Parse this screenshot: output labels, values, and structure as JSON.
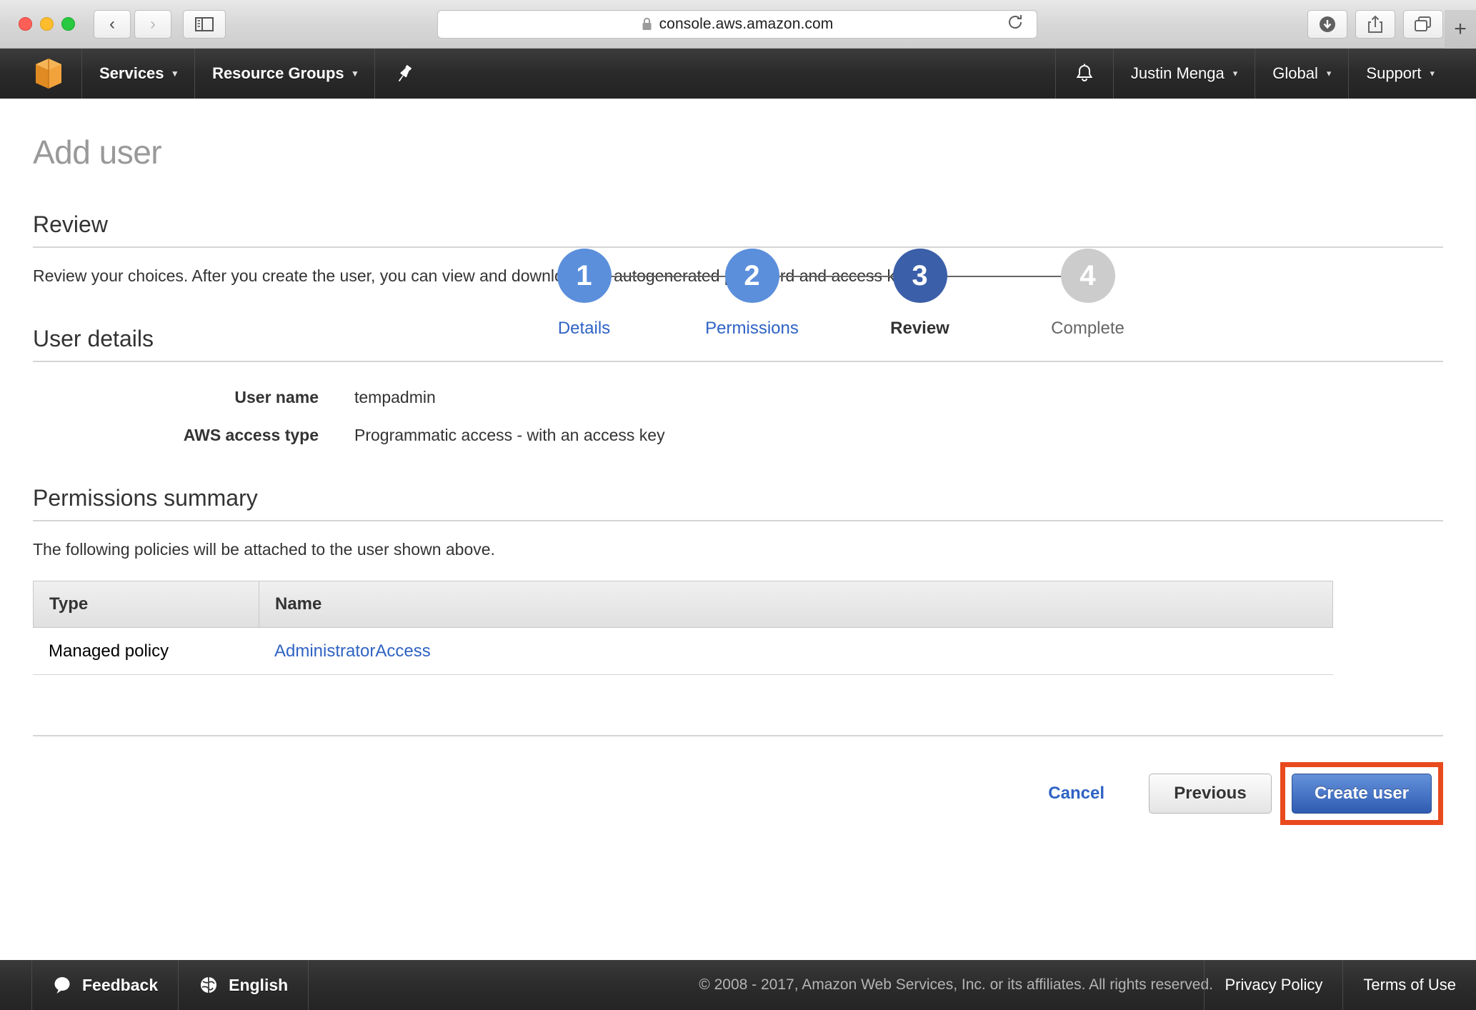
{
  "browser": {
    "url": "console.aws.amazon.com",
    "lock_icon": "lock-icon",
    "back_icon": "back-arrow-icon",
    "forward_icon": "forward-arrow-icon",
    "sidebar_icon": "sidebar-toggle-icon",
    "reload_icon": "reload-icon",
    "downloads_icon": "downloads-icon",
    "share_icon": "share-icon",
    "tabs_icon": "tab-overview-icon",
    "new_tab_label": "+"
  },
  "topnav": {
    "logo_icon": "aws-cube-logo-icon",
    "services_label": "Services",
    "resource_groups_label": "Resource Groups",
    "pin_icon": "pin-icon",
    "bell_icon": "bell-icon",
    "account_label": "Justin Menga",
    "region_label": "Global",
    "support_label": "Support",
    "caret": "▾"
  },
  "page": {
    "title": "Add user"
  },
  "wizard": {
    "steps": [
      {
        "number": "1",
        "label": "Details",
        "state": "done",
        "circle_color": "#5b8fdb",
        "label_color": "#2f63c4"
      },
      {
        "number": "2",
        "label": "Permissions",
        "state": "done",
        "circle_color": "#5b8fdb",
        "label_color": "#2f63c4"
      },
      {
        "number": "3",
        "label": "Review",
        "state": "current",
        "circle_color": "#3b5fa8",
        "label_color": "#333333"
      },
      {
        "number": "4",
        "label": "Complete",
        "state": "pending",
        "circle_color": "#cccccc",
        "label_color": "#666666"
      }
    ]
  },
  "review": {
    "heading": "Review",
    "description": "Review your choices. After you create the user, you can view and download the autogenerated password and access key."
  },
  "user_details": {
    "heading": "User details",
    "rows": [
      {
        "label": "User name",
        "value": "tempadmin"
      },
      {
        "label": "AWS access type",
        "value": "Programmatic access - with an access key"
      }
    ]
  },
  "permissions_summary": {
    "heading": "Permissions summary",
    "description": "The following policies will be attached to the user shown above.",
    "columns": [
      "Type",
      "Name"
    ],
    "rows": [
      {
        "type": "Managed policy",
        "name": "AdministratorAccess"
      }
    ]
  },
  "actions": {
    "cancel_label": "Cancel",
    "previous_label": "Previous",
    "create_label": "Create user",
    "highlight_color": "#e8491d"
  },
  "footer": {
    "feedback_icon": "speech-bubble-icon",
    "feedback_label": "Feedback",
    "language_icon": "globe-icon",
    "language_label": "English",
    "copyright": "© 2008 - 2017, Amazon Web Services, Inc. or its affiliates. All rights reserved.",
    "privacy_label": "Privacy Policy",
    "terms_label": "Terms of Use"
  }
}
